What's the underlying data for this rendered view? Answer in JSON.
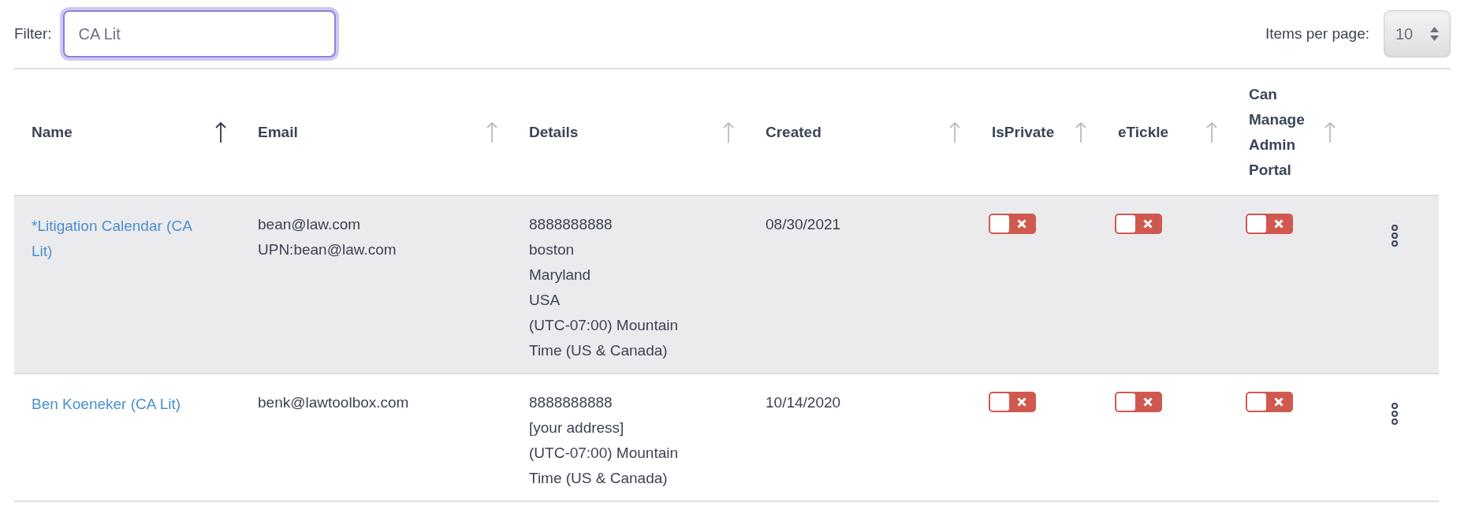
{
  "filter": {
    "label": "Filter:",
    "value": "CA Lit"
  },
  "pager": {
    "label": "Items per page:",
    "value": "10"
  },
  "table": {
    "columns": [
      {
        "label": "Name",
        "sorted": true
      },
      {
        "label": "Email",
        "sorted": false
      },
      {
        "label": "Details",
        "sorted": false
      },
      {
        "label": "Created",
        "sorted": false
      },
      {
        "label": "IsPrivate",
        "sorted": false
      },
      {
        "label": "eTickle",
        "sorted": false
      },
      {
        "label": "Can Manage Admin Portal",
        "sorted": false
      }
    ],
    "rows": [
      {
        "selected": true,
        "name": "*Litigation Calendar (CA Lit)",
        "email": [
          "bean@law.com",
          "UPN:bean@law.com"
        ],
        "details": [
          "8888888888",
          "boston",
          "Maryland",
          "USA",
          "(UTC-07:00) Mountain Time (US & Canada)"
        ],
        "created": "08/30/2021",
        "is_private": false,
        "etickle": false,
        "can_manage_admin_portal": false
      },
      {
        "selected": false,
        "name": "Ben Koeneker (CA Lit)",
        "email": [
          "benk@lawtoolbox.com"
        ],
        "details": [
          "8888888888",
          "[your address]",
          "(UTC-07:00) Mountain Time (US & Canada)"
        ],
        "created": "10/14/2020",
        "is_private": false,
        "etickle": false,
        "can_manage_admin_portal": false
      }
    ]
  }
}
